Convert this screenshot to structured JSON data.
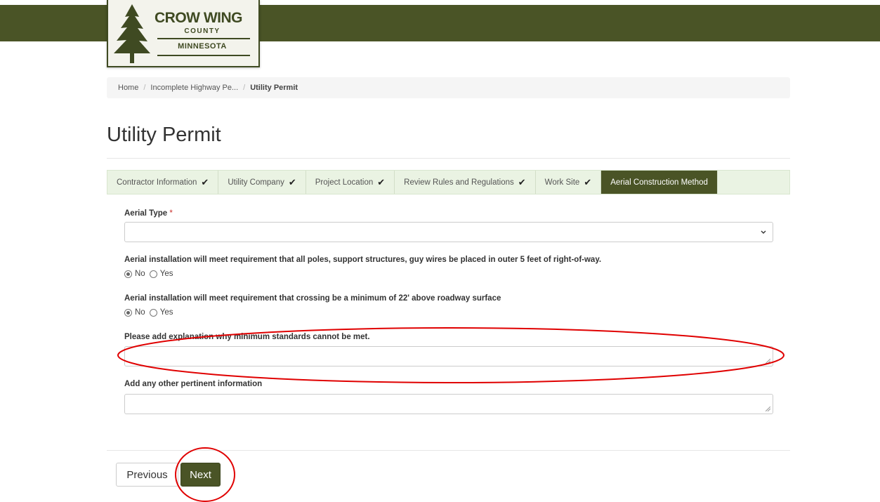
{
  "logo": {
    "line1": "CROW WING",
    "line2": "COUNTY",
    "line3": "MINNESOTA"
  },
  "breadcrumb": {
    "home": "Home",
    "parent": "Incomplete Highway Pe...",
    "current": "Utility Permit",
    "separator": "/"
  },
  "page": {
    "title": "Utility Permit"
  },
  "tabs": [
    {
      "label": "Contractor Information",
      "complete": true
    },
    {
      "label": "Utility Company",
      "complete": true
    },
    {
      "label": "Project Location",
      "complete": true
    },
    {
      "label": "Review Rules and Regulations",
      "complete": true
    },
    {
      "label": "Work Site",
      "complete": true
    },
    {
      "label": "Aerial Construction Method",
      "active": true
    }
  ],
  "form": {
    "aerial_type": {
      "label": "Aerial Type",
      "required_mark": "*",
      "value": ""
    },
    "q1": {
      "label": "Aerial installation will meet requirement that all poles, support structures, guy wires be placed in outer 5 feet of right-of-way.",
      "options": [
        "No",
        "Yes"
      ],
      "selected": "No"
    },
    "q2": {
      "label": "Aerial installation will meet requirement that crossing be a minimum of 22' above roadway surface",
      "options": [
        "No",
        "Yes"
      ],
      "selected": "No"
    },
    "explanation": {
      "label": "Please add explanation why minimum standards cannot be met.",
      "value": ""
    },
    "other_info": {
      "label": "Add any other pertinent information",
      "value": ""
    }
  },
  "buttons": {
    "previous": "Previous",
    "next": "Next"
  },
  "colors": {
    "brand": "#4a5426",
    "tab_bg": "#eaf3e3",
    "annotation": "#e00000"
  }
}
